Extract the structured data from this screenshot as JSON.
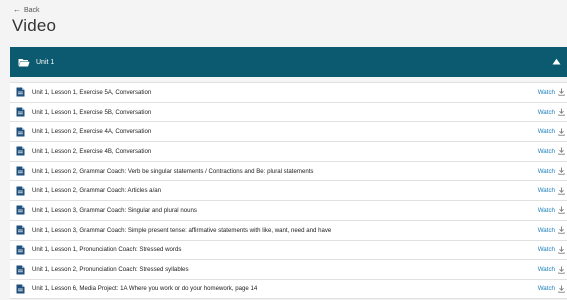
{
  "nav": {
    "back_label": "Back"
  },
  "page": {
    "title": "Video"
  },
  "unit": {
    "title": "Unit 1",
    "accent": "#0b5a70",
    "link_color": "#1d7fb8"
  },
  "items": [
    {
      "label": "Unit 1, Lesson 1, Exercise 5A, Conversation",
      "action": "Watch"
    },
    {
      "label": "Unit 1, Lesson 1, Exercise 5B, Conversation",
      "action": "Watch"
    },
    {
      "label": "Unit 1, Lesson 2, Exercise 4A, Conversation",
      "action": "Watch"
    },
    {
      "label": "Unit 1, Lesson 2, Exercise 4B, Conversation",
      "action": "Watch"
    },
    {
      "label": "Unit 1, Lesson 2, Grammar Coach: Verb be singular statements / Contractions and Be: plural statements",
      "action": "Watch"
    },
    {
      "label": "Unit 1, Lesson 2, Grammar Coach: Articles a/an",
      "action": "Watch"
    },
    {
      "label": "Unit 1, Lesson 3, Grammar Coach: Singular and plural nouns",
      "action": "Watch"
    },
    {
      "label": "Unit 1, Lesson 3, Grammar Coach: Simple present tense: affirmative statements with like, want, need and have",
      "action": "Watch"
    },
    {
      "label": "Unit 1, Lesson 1, Pronunciation Coach: Stressed words",
      "action": "Watch"
    },
    {
      "label": "Unit 1, Lesson 2, Pronunciation Coach: Stressed syllables",
      "action": "Watch"
    },
    {
      "label": "Unit 1, Lesson 6, Media Project: 1A Where you work or do your homework, page 14",
      "action": "Watch"
    }
  ]
}
